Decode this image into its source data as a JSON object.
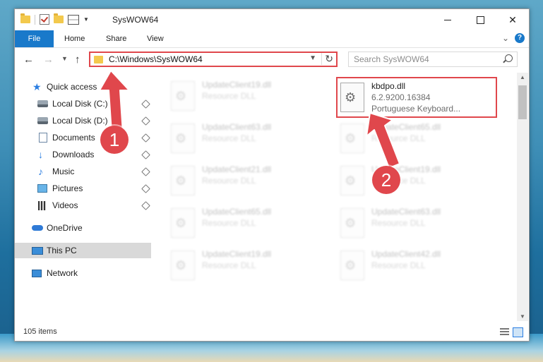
{
  "window": {
    "title": "SysWOW64"
  },
  "ribbon": {
    "tabs": [
      "File",
      "Home",
      "Share",
      "View"
    ]
  },
  "address": {
    "path": "C:\\Windows\\SysWOW64"
  },
  "search": {
    "placeholder": "Search SysWOW64"
  },
  "sidebar": {
    "items": [
      {
        "label": "Quick access",
        "icon": "star-icon"
      },
      {
        "label": "Local Disk (C:)",
        "icon": "disk-icon",
        "pinned": true
      },
      {
        "label": "Local Disk (D:)",
        "icon": "disk-icon",
        "pinned": true
      },
      {
        "label": "Documents",
        "icon": "documents-icon",
        "pinned": true
      },
      {
        "label": "Downloads",
        "icon": "download-icon",
        "pinned": true
      },
      {
        "label": "Music",
        "icon": "music-icon",
        "pinned": true
      },
      {
        "label": "Pictures",
        "icon": "pictures-icon",
        "pinned": true
      },
      {
        "label": "Videos",
        "icon": "videos-icon",
        "pinned": true
      },
      {
        "label": "OneDrive",
        "icon": "onedrive-icon"
      },
      {
        "label": "This PC",
        "icon": "pc-icon",
        "selected": true
      },
      {
        "label": "Network",
        "icon": "network-icon"
      }
    ]
  },
  "files": {
    "left": [
      {
        "name": "UpdateClient19.dll",
        "type": "Resource DLL"
      },
      {
        "name": "UpdateClient63.dll",
        "type": "Resource DLL"
      },
      {
        "name": "UpdateClient21.dll",
        "type": "Resource DLL"
      },
      {
        "name": "UpdateClient65.dll",
        "type": "Resource DLL"
      },
      {
        "name": "UpdateClient19.dll",
        "type": "Resource DLL"
      }
    ],
    "right": [
      {
        "name": "kbdpo.dll",
        "version": "6.2.9200.16384",
        "description": "Portuguese Keyboard...",
        "highlighted": true
      },
      {
        "name": "UpdateClient65.dll",
        "type": "Resource DLL"
      },
      {
        "name": "UpdateClient19.dll",
        "type": "Resource DLL"
      },
      {
        "name": "UpdateClient63.dll",
        "type": "Resource DLL"
      },
      {
        "name": "UpdateClient42.dll",
        "type": "Resource DLL"
      }
    ]
  },
  "status": {
    "count": "105 items"
  },
  "annotations": {
    "step1": "1",
    "step2": "2",
    "color": "#e0474c"
  }
}
